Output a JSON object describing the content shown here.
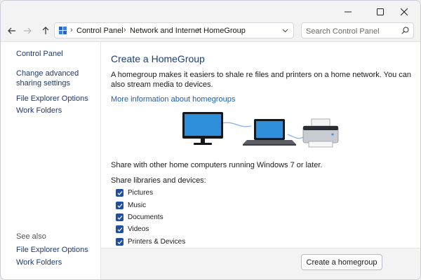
{
  "window": {
    "controls": {
      "minimize_icon": "minimize-icon",
      "maximize_icon": "maximize-icon",
      "close_icon": "close-icon"
    }
  },
  "nav": {
    "back_icon": "arrow-left-icon",
    "forward_icon": "arrow-right-icon",
    "up_icon": "arrow-up-icon",
    "breadcrumb": [
      "Control Panel",
      "Network and Internet",
      "HomeGroup"
    ],
    "search_placeholder": "Search Control Panel"
  },
  "sidebar": {
    "home_link": "Control Panel",
    "links": [
      "Change advanced sharing settings",
      "File Explorer Options",
      "Work Folders"
    ],
    "see_also_label": "See also",
    "see_also_links": [
      "File Explorer Options",
      "Work Folders"
    ]
  },
  "main": {
    "title": "Create a HomeGroup",
    "intro": "A homegroup makes it easiers to shale re files and printers on a home network. You can also stream media to devices.",
    "more_info_link": "More information about homegroups",
    "share_text": "Share with other home computers running Windows 7 or later.",
    "libraries_label": "Share libraries and devices:",
    "libraries": [
      {
        "label": "Pictures",
        "checked": true
      },
      {
        "label": "Music",
        "checked": true
      },
      {
        "label": "Documents",
        "checked": true
      },
      {
        "label": "Videos",
        "checked": true
      },
      {
        "label": "Printers & Devices",
        "checked": true
      }
    ]
  },
  "footer": {
    "create_button": "Create a homegroup"
  },
  "colors": {
    "accent": "#1e4fa3",
    "link": "#1a5fb4",
    "title": "#1e3f78"
  }
}
